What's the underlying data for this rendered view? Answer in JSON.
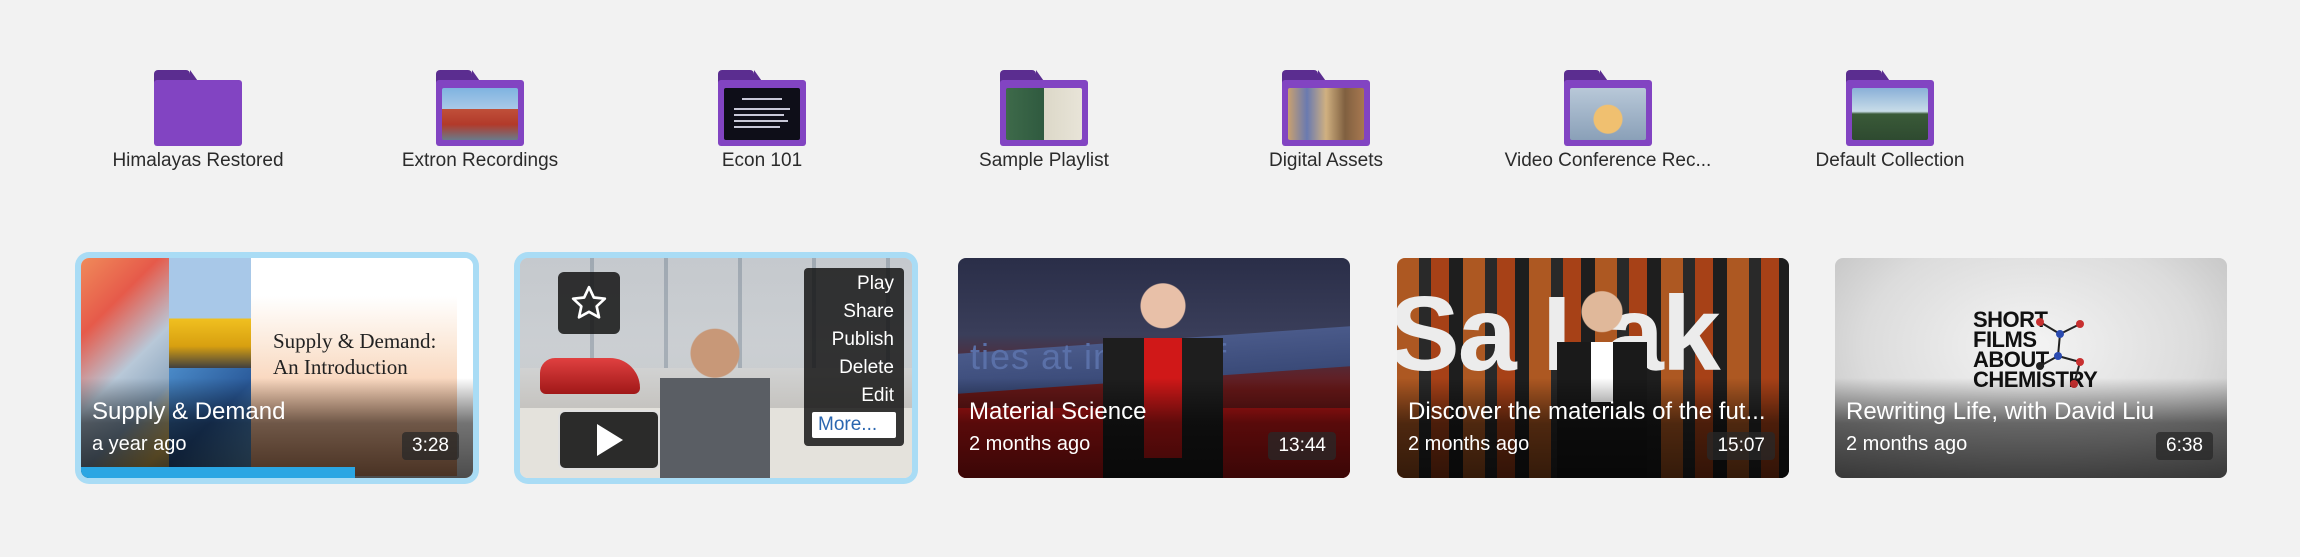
{
  "folders": [
    {
      "label": "Himalayas Restored",
      "thumb": "empty"
    },
    {
      "label": "Extron Recordings",
      "thumb": "building"
    },
    {
      "label": "Econ 101",
      "thumb": "slide"
    },
    {
      "label": "Sample Playlist",
      "thumb": "classroom"
    },
    {
      "label": "Digital Assets",
      "thumb": "group"
    },
    {
      "label": "Video Conference Rec...",
      "thumb": "portrait"
    },
    {
      "label": "Default Collection",
      "thumb": "landscape"
    }
  ],
  "videos": [
    {
      "title": "Supply & Demand",
      "date": "a year ago",
      "duration": "3:28",
      "selected": true,
      "progress": 0.7,
      "slide_title_1": "Supply & Demand:",
      "slide_title_2": "An Introduction"
    },
    {
      "title": "",
      "date": "",
      "duration": "",
      "selected": true,
      "hover": true
    },
    {
      "title": "Material Science",
      "date": "2 months ago",
      "duration": "13:44",
      "thumb_text": "ties at in      ces of"
    },
    {
      "title": "Discover the materials of the fut...",
      "date": "2 months ago",
      "duration": "15:07",
      "thumb_text": "Sa Lak"
    },
    {
      "title": "Rewriting Life, with David Liu",
      "date": "2 months ago",
      "duration": "6:38",
      "logo_lines": [
        "SHORT",
        "FILMS",
        "ABOUT",
        "CHEMISTRY"
      ]
    }
  ],
  "hover_menu": {
    "items": [
      "Play",
      "Share",
      "Publish",
      "Delete",
      "Edit"
    ],
    "more": "More..."
  },
  "colors": {
    "folder": "#8244c2",
    "folder_tab": "#5b2d90",
    "selection": "#a9dcf5",
    "progress": "#2aa6e3"
  },
  "icons": {
    "star": "star-icon",
    "play": "play-icon"
  }
}
